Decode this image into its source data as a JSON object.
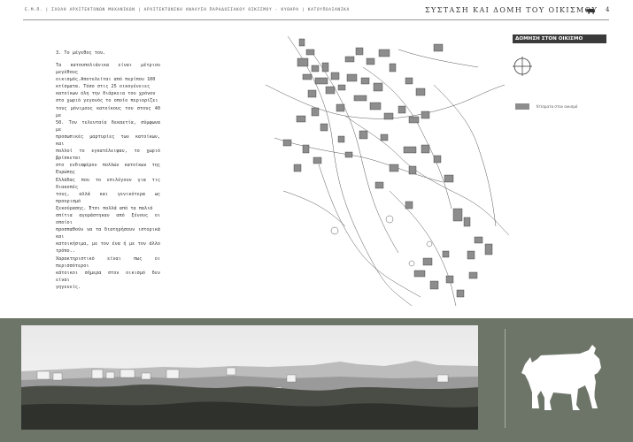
{
  "header": {
    "left": "Ε.Μ.Π. | ΣΧΟΛΗ ΑΡΧΙΤΕΚΤΟΝΩΝ ΜΗΧΑΝΙΚΩΝ | ΑΡΧΙΤΕΚΤΟΝΙΚΗ ΑΝΑΛΥΣΗ ΠΑΡΑΔΟΣΙΑΚΟΥ ΟΙΚΙΣΜΟΥ - ΚΥΘΗΡΑ | ΚΑΤΟΥΠΟΛΙΑΝΙΚΑ",
    "title": "ΣΥΣΤΑΣΗ ΚΑΙ ΔΟΜΗ ΤΟΥ ΟΙΚΙΣΜΟΥ",
    "page_number": "4",
    "icon": "ox-icon"
  },
  "text": {
    "section": "3. Το μέγεθος του.",
    "lines": [
      "Τα κατουπολιάνικα είναι μέτριου μεγέθους",
      "οικισμός.Αποτελείται από περίπου 100",
      "κτίσματα. Τόσο στις 25 οικογένειες",
      "κατοίκων όλη την διάρκεια του χρόνου",
      "στο χωριό γεγονός το οποίο περιορίζει",
      "τους μόνιμους κατοίκους του στους 40 με",
      "50. Τον τελευταία δεκαετία, σύμφωνα με",
      "προσωπικές μαρτυρίες των κατοίκων, και",
      "πολλοί το εγκατέλειψαν, το χωριό βρίσκεται",
      "στο ενδιαφέρον πολλών κατοίκων της Ευρώπης",
      "Ελλάδας που το επιλέγουν για τις διακοπές",
      "τους, αλλά και γενικότερα ως προορισμό",
      "ξεκούρασης. Έτσι πολλά από τα παλιά",
      "σπίτια αγοράστηκαν από ξένους οι οποίοι",
      "προσπαθούν να τα διατηρήσουν ιστορικά και",
      "κατοικήσιμα, με τον ένα ή με τον άλλο τρόπο..",
      "Χαρακτηριστικό είναι πως οι περισσότεροι",
      "κάτοικοι σήμερα στον οικισμό δεν είναι",
      "γηγενείς."
    ]
  },
  "legend": {
    "title": "ΔΟΜΗΣΗ ΣΤΟΝ ΟΙΚΙΣΜΟ",
    "item_label": "Κτίσματα στον οικισμό",
    "swatch_color": "#8d8d8d",
    "compass_icon": "north-compass-icon"
  },
  "colors": {
    "band": "#6d7568",
    "building": "#8d8d8d",
    "header_bar": "#3a3a3a"
  },
  "figures": {
    "map": "village-site-plan",
    "photo": "village-panorama-photo",
    "emblem": "ox-silhouette-icon"
  }
}
